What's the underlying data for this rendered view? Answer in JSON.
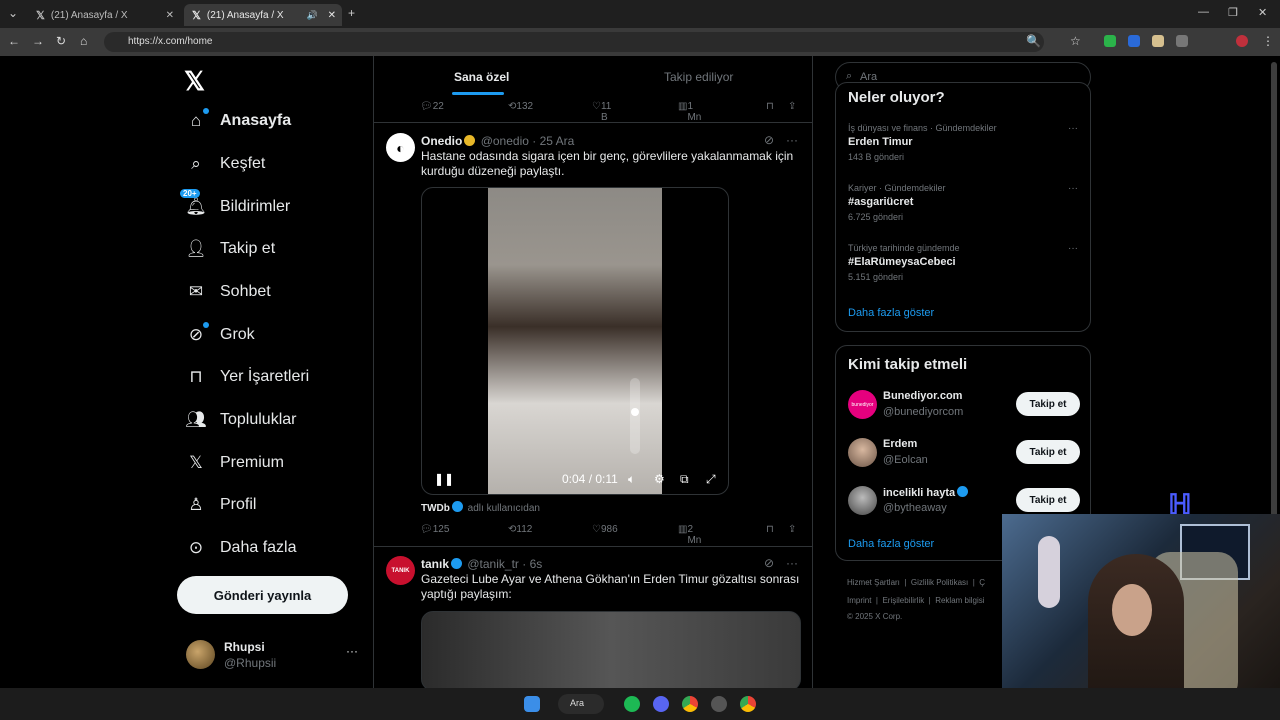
{
  "browser": {
    "tabs": [
      {
        "title": "(21) Anasayfa / X"
      },
      {
        "title": "(21) Anasayfa / X"
      }
    ],
    "url": "https://x.com/home"
  },
  "sidebar": {
    "items": [
      {
        "label": "Anasayfa",
        "icon": "home-icon"
      },
      {
        "label": "Keşfet",
        "icon": "search-icon"
      },
      {
        "label": "Bildirimler",
        "icon": "bell-icon",
        "badge": "20+"
      },
      {
        "label": "Takip et",
        "icon": "add-person-icon"
      },
      {
        "label": "Sohbet",
        "icon": "mail-icon"
      },
      {
        "label": "Grok",
        "icon": "grok-icon"
      },
      {
        "label": "Yer İşaretleri",
        "icon": "bookmark-icon"
      },
      {
        "label": "Topluluklar",
        "icon": "communities-icon"
      },
      {
        "label": "Premium",
        "icon": "x-logo-icon"
      },
      {
        "label": "Profil",
        "icon": "person-icon"
      },
      {
        "label": "Daha fazla",
        "icon": "more-circle-icon"
      }
    ],
    "post_button": "Gönderi yayınla",
    "user": {
      "name": "Rhupsi",
      "handle": "@Rhupsii"
    }
  },
  "feed": {
    "tabs": [
      {
        "label": "Sana özel"
      },
      {
        "label": "Takip ediliyor"
      }
    ],
    "prev_actions": {
      "replies": "22",
      "reposts": "132",
      "likes": "11 B",
      "views": "1 Mn"
    },
    "tweets": [
      {
        "name": "Onedio",
        "handle": "@onedio",
        "time": "25 Ara",
        "text": "Hastane odasında sigara içen bir genç, görevlilere yakalanmamak için kurduğu düzeneği paylaştı.",
        "video_time": "0:04 / 0:11",
        "source_user": "TWDb",
        "source_suffix": "adlı kullanıcıdan",
        "actions": {
          "replies": "125",
          "reposts": "112",
          "likes": "986",
          "views": "2 Mn"
        },
        "video_progress": 0.36
      },
      {
        "name": "tanık",
        "handle": "@tanik_tr",
        "time": "6s",
        "avatar_text": "TANIK",
        "text": "Gazeteci Lube Ayar ve Athena Gökhan'ın Erden Timur gözaltısı sonrası yaptığı paylaşım:"
      }
    ]
  },
  "right": {
    "search_placeholder": "Ara",
    "trends_title": "Neler oluyor?",
    "trends": [
      {
        "context": "İş dünyası ve finans · Gündemdekiler",
        "name": "Erden Timur",
        "count": "143 B gönderi"
      },
      {
        "context": "Kariyer · Gündemdekiler",
        "name": "#asgariücret",
        "count": "6.725 gönderi"
      },
      {
        "context": "Türkiye tarihinde gündemde",
        "name": "#ElaRümeysaCebeci",
        "count": "5.151 gönderi"
      }
    ],
    "trends_more": "Daha fazla göster",
    "who_title": "Kimi takip etmeli",
    "who": [
      {
        "name": "Bunediyor.com",
        "handle": "@bunediyorcom",
        "verified": false,
        "avatar_text": "bunediyor"
      },
      {
        "name": "Erdem",
        "handle": "@Eolcan",
        "verified": false
      },
      {
        "name": "incelikli hayta",
        "handle": "@bytheaway",
        "verified": true
      }
    ],
    "follow_label": "Takip et",
    "who_more": "Daha fazla göster",
    "footer": [
      "Hizmet Şartları",
      "|",
      "Gizlilik Politikası",
      "|",
      "Ç",
      "Imprint",
      "|",
      "Erişilebilirlik",
      "|",
      "Reklam bilgisi"
    ],
    "copyright": "© 2025 X Corp."
  },
  "taskbar": {
    "search": "Ara"
  },
  "colors": {
    "accent": "#1d9bf0",
    "background": "#000000",
    "border": "#2f3336",
    "muted": "#71767b"
  }
}
